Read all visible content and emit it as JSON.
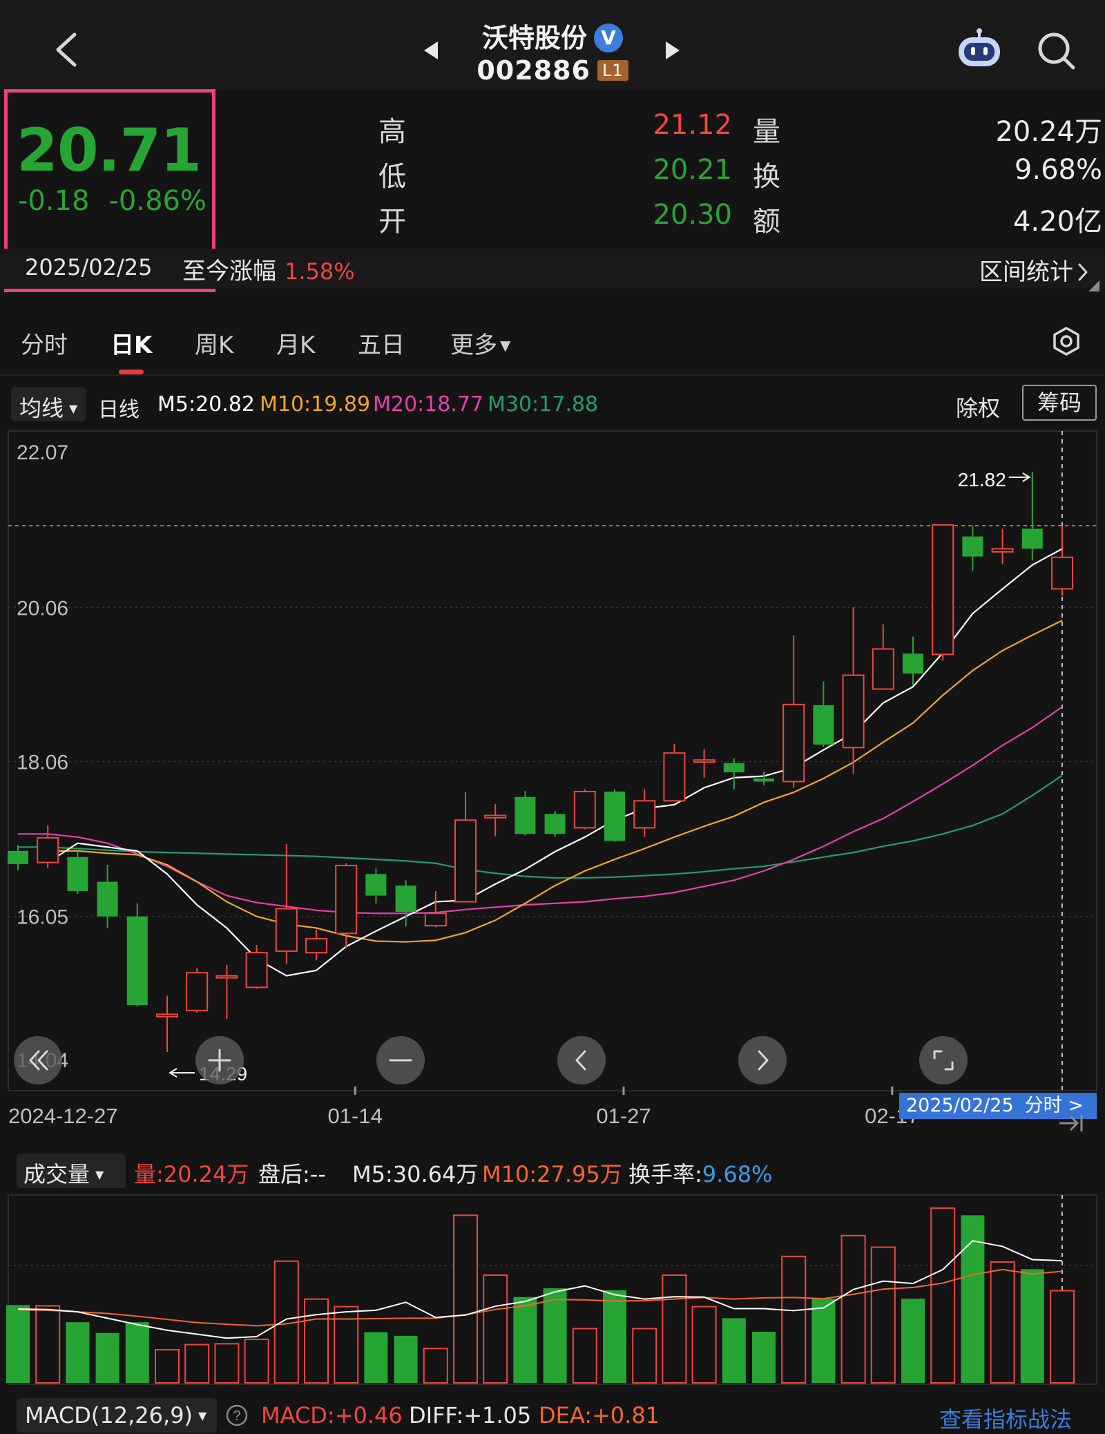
{
  "header": {
    "stock_name": "沃特股份",
    "verified_mark": "V",
    "stock_code": "002886",
    "level_badge": "L1",
    "icons": [
      "back-icon",
      "prev-stock-icon",
      "next-stock-icon",
      "robot-assistant-icon",
      "search-icon"
    ]
  },
  "quote": {
    "price": "20.71",
    "change": "-0.18",
    "change_pct": "-0.86%",
    "date": "2025/02/25",
    "gain_label": "至今涨幅",
    "gain_value": "1.58%",
    "range_stats": "区间统计",
    "stats": [
      {
        "label": "高",
        "value": "21.12",
        "color": "red"
      },
      {
        "label": "低",
        "value": "20.21",
        "color": "green"
      },
      {
        "label": "开",
        "value": "20.30",
        "color": "green"
      }
    ],
    "stats2": [
      {
        "label": "量",
        "value": "20.24万"
      },
      {
        "label": "换",
        "value": "9.68%"
      },
      {
        "label": "额",
        "value": "4.20亿"
      }
    ]
  },
  "tabs": [
    "分时",
    "日K",
    "周K",
    "月K",
    "五日",
    "更多"
  ],
  "active_tab": "日K",
  "ma_bar": {
    "select": "均线",
    "period": "日线",
    "m5": "M5:20.82",
    "m10": "M10:19.89",
    "m20": "M20:18.77",
    "m30": "M30:17.88",
    "exright": "除权",
    "chips": "筹码"
  },
  "colors": {
    "up": "#f0463c",
    "down": "#27a534",
    "m5": "#ffffff",
    "m10": "#f5a623",
    "m20": "#e83fae",
    "m30": "#1f9e70",
    "accent": "#3574d6"
  },
  "chart_data": {
    "type": "candlestick",
    "y_ticks": [
      "22.07",
      "20.06",
      "18.06",
      "16.05",
      "14.04"
    ],
    "ylim": [
      14.04,
      22.07
    ],
    "x_labels": [
      "2024-12-27",
      "01-14",
      "01-27",
      "02-17"
    ],
    "annot_high": "21.82",
    "annot_low": "14.29",
    "date_badge": "2025/02/25",
    "date_badge_link": "分时 >",
    "candles": [
      {
        "o": 16.9,
        "c": 16.73,
        "h": 16.98,
        "l": 16.65
      },
      {
        "o": 16.75,
        "c": 17.07,
        "h": 17.23,
        "l": 16.68
      },
      {
        "o": 16.82,
        "c": 16.38,
        "h": 16.9,
        "l": 16.34
      },
      {
        "o": 16.5,
        "c": 16.05,
        "h": 16.72,
        "l": 15.9
      },
      {
        "o": 16.05,
        "c": 14.9,
        "h": 16.22,
        "l": 14.88
      },
      {
        "o": 14.75,
        "c": 14.78,
        "h": 15.02,
        "l": 14.29
      },
      {
        "o": 14.83,
        "c": 15.32,
        "h": 15.38,
        "l": 14.8
      },
      {
        "o": 15.26,
        "c": 15.28,
        "h": 15.42,
        "l": 14.72
      },
      {
        "o": 15.13,
        "c": 15.58,
        "h": 15.68,
        "l": 15.11
      },
      {
        "o": 15.6,
        "c": 16.15,
        "h": 16.99,
        "l": 15.43
      },
      {
        "o": 15.58,
        "c": 15.76,
        "h": 15.88,
        "l": 15.48
      },
      {
        "o": 15.83,
        "c": 16.71,
        "h": 16.74,
        "l": 15.64
      },
      {
        "o": 16.6,
        "c": 16.32,
        "h": 16.67,
        "l": 16.22
      },
      {
        "o": 16.45,
        "c": 16.11,
        "h": 16.52,
        "l": 15.92
      },
      {
        "o": 15.93,
        "c": 16.09,
        "h": 16.38,
        "l": 15.91
      },
      {
        "o": 16.24,
        "c": 17.3,
        "h": 17.66,
        "l": 16.24
      },
      {
        "o": 17.33,
        "c": 17.36,
        "h": 17.51,
        "l": 17.09
      },
      {
        "o": 17.6,
        "c": 17.12,
        "h": 17.68,
        "l": 17.1
      },
      {
        "o": 17.38,
        "c": 17.12,
        "h": 17.42,
        "l": 17.08
      },
      {
        "o": 17.2,
        "c": 17.67,
        "h": 17.7,
        "l": 17.18
      },
      {
        "o": 17.67,
        "c": 17.03,
        "h": 17.7,
        "l": 17.02
      },
      {
        "o": 17.2,
        "c": 17.55,
        "h": 17.7,
        "l": 17.08
      },
      {
        "o": 17.55,
        "c": 18.17,
        "h": 18.29,
        "l": 17.55
      },
      {
        "o": 18.06,
        "c": 18.08,
        "h": 18.22,
        "l": 17.85
      },
      {
        "o": 18.04,
        "c": 17.92,
        "h": 18.1,
        "l": 17.7
      },
      {
        "o": 17.84,
        "c": 17.8,
        "h": 17.93,
        "l": 17.75
      },
      {
        "o": 17.8,
        "c": 18.8,
        "h": 19.7,
        "l": 17.72
      },
      {
        "o": 18.79,
        "c": 18.28,
        "h": 19.1,
        "l": 18.25
      },
      {
        "o": 18.24,
        "c": 19.18,
        "h": 20.06,
        "l": 17.9
      },
      {
        "o": 19.0,
        "c": 19.52,
        "h": 19.84,
        "l": 19.0
      },
      {
        "o": 19.46,
        "c": 19.2,
        "h": 19.68,
        "l": 19.05
      },
      {
        "o": 19.45,
        "c": 21.13,
        "h": 21.13,
        "l": 19.37
      },
      {
        "o": 20.98,
        "c": 20.72,
        "h": 21.12,
        "l": 20.53
      },
      {
        "o": 20.78,
        "c": 20.82,
        "h": 21.08,
        "l": 20.62
      },
      {
        "o": 21.08,
        "c": 20.82,
        "h": 21.82,
        "l": 20.67
      },
      {
        "o": 20.3,
        "c": 20.71,
        "h": 21.12,
        "l": 20.21
      }
    ],
    "ma5": [
      16.75,
      17.0,
      16.95,
      16.9,
      16.6,
      16.2,
      15.9,
      15.5,
      15.28,
      15.35,
      15.66,
      15.86,
      16.05,
      16.24,
      16.26,
      16.47,
      16.66,
      16.89,
      17.08,
      17.3,
      17.45,
      17.5,
      17.72,
      17.85,
      17.87,
      17.98,
      18.21,
      18.43,
      18.82,
      19.03,
      19.47,
      19.98,
      20.3,
      20.61,
      20.82
    ],
    "ma10": [
      16.9,
      16.9,
      16.87,
      16.85,
      16.72,
      16.5,
      16.24,
      16.05,
      15.95,
      15.9,
      15.8,
      15.73,
      15.72,
      15.74,
      15.84,
      16.0,
      16.22,
      16.45,
      16.64,
      16.79,
      16.93,
      17.08,
      17.22,
      17.35,
      17.53,
      17.66,
      17.84,
      18.05,
      18.31,
      18.56,
      18.92,
      19.24,
      19.5,
      19.7,
      19.89
    ],
    "ma20": [
      17.12,
      17.12,
      17.08,
      17.0,
      16.86,
      16.7,
      16.5,
      16.32,
      16.23,
      16.18,
      16.13,
      16.1,
      16.09,
      16.09,
      16.1,
      16.14,
      16.17,
      16.2,
      16.22,
      16.24,
      16.28,
      16.31,
      16.36,
      16.44,
      16.52,
      16.64,
      16.79,
      16.96,
      17.15,
      17.32,
      17.54,
      17.77,
      18.01,
      18.27,
      18.5,
      18.77
    ],
    "ma30": [
      16.95,
      16.95,
      16.93,
      16.91,
      16.89,
      16.88,
      16.87,
      16.86,
      16.85,
      16.84,
      16.83,
      16.81,
      16.79,
      16.77,
      16.74,
      16.66,
      16.61,
      16.57,
      16.55,
      16.55,
      16.56,
      16.58,
      16.6,
      16.63,
      16.67,
      16.7,
      16.76,
      16.82,
      16.88,
      16.96,
      17.03,
      17.12,
      17.23,
      17.38,
      17.62,
      17.88
    ],
    "volume": {
      "title": "成交量",
      "vol_label": "量:20.24万",
      "after_hours": "盘后:--",
      "m5": "M5:30.64万",
      "m10": "M10:27.95万",
      "turnover_label": "换手率:",
      "turnover_value": "9.68%",
      "bars": [
        19.5,
        19.3,
        15.2,
        12.5,
        15.2,
        8.3,
        9.6,
        9.8,
        10.9,
        30.5,
        21.0,
        19.1,
        12.7,
        11.8,
        8.6,
        42.0,
        27.0,
        21.5,
        23.7,
        13.6,
        23.2,
        13.6,
        27.0,
        19.1,
        16.2,
        12.8,
        31.7,
        21.1,
        36.9,
        34.0,
        21.1,
        43.8,
        42.0,
        30.3,
        28.5,
        23.1
      ],
      "ma5": [
        18.5,
        18.4,
        17.8,
        16.2,
        14.6,
        13.2,
        12.2,
        11.2,
        11.6,
        16.0,
        17.1,
        17.8,
        18.2,
        20.2,
        16.4,
        17.0,
        19.2,
        20.4,
        22.8,
        24.3,
        22.1,
        21.0,
        21.6,
        21.5,
        18.6,
        18.6,
        18.1,
        18.8,
        23.4,
        25.5,
        24.9,
        28.4,
        35.6,
        34.2,
        30.9,
        30.6
      ],
      "ma10": [
        18.3,
        18.2,
        17.8,
        17.4,
        16.7,
        15.9,
        15.1,
        14.7,
        14.3,
        14.8,
        16.0,
        16.0,
        16.1,
        16.2,
        16.2,
        17.1,
        18.4,
        19.3,
        20.9,
        20.8,
        20.5,
        20.6,
        21.0,
        21.4,
        21.0,
        21.3,
        21.4,
        21.1,
        22.2,
        23.5,
        23.9,
        25.0,
        27.1,
        28.4,
        27.3,
        27.95
      ]
    },
    "macd": {
      "name": "MACD(12,26,9)",
      "macd": "MACD:+0.46",
      "diff": "DIFF:+1.05",
      "dea": "DEA:+0.81",
      "link": "查看指标战法"
    }
  }
}
